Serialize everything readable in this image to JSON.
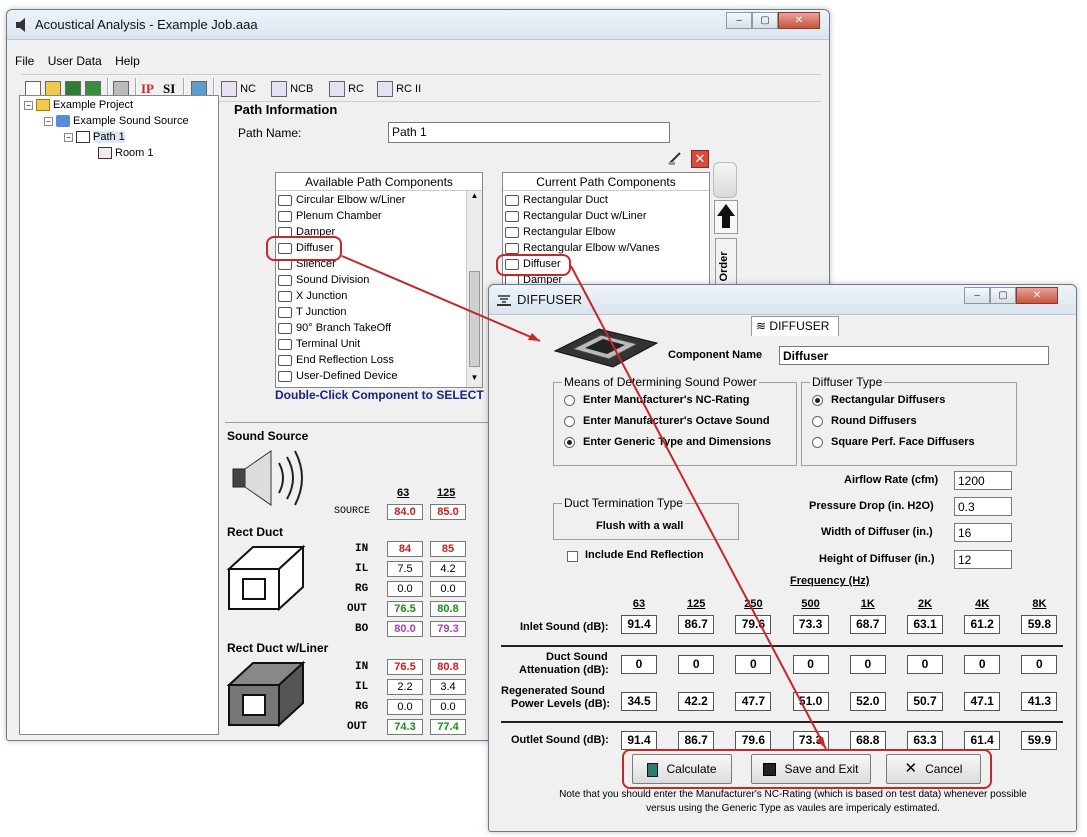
{
  "main_window": {
    "title": "Acoustical Analysis - Example Job.aaa",
    "menu": [
      "File",
      "User Data",
      "Help"
    ],
    "toolbar": {
      "ip": "IP",
      "si": "SI",
      "nc": "NC",
      "ncb": "NCB",
      "rc": "RC",
      "rc2": "RC II"
    }
  },
  "tree": {
    "project": "Example Project",
    "source": "Example Sound Source",
    "path": "Path 1",
    "room": "Room 1"
  },
  "path_info": {
    "heading": "Path Information",
    "name_label": "Path Name:",
    "name_value": "Path 1"
  },
  "available": {
    "header": "Available Path Components",
    "items": [
      "Circular Elbow w/Liner",
      "Plenum Chamber",
      "Damper",
      "Diffuser",
      "Silencer",
      "Sound Division",
      "X Junction",
      "T Junction",
      "90° Branch TakeOff",
      "Terminal Unit",
      "End Reflection Loss",
      "User-Defined Device"
    ],
    "hint": "Double-Click Component to SELECT"
  },
  "current": {
    "header": "Current Path Components",
    "items": [
      "Rectangular Duct",
      "Rectangular Duct w/Liner",
      "Rectangular Elbow",
      "Rectangular Elbow w/Vanes",
      "Diffuser",
      "Damper"
    ],
    "order_label": "ent Order"
  },
  "analysis": {
    "sound_source_label": "Sound Source",
    "freq_headers": [
      "63",
      "125"
    ],
    "source_label": "SOURCE",
    "source_values": [
      "84.0",
      "85.0"
    ],
    "rect_duct_label": "Rect Duct",
    "rect_duct_rows": [
      {
        "label": "IN",
        "values": [
          "84",
          "85"
        ],
        "color": "red"
      },
      {
        "label": "IL",
        "values": [
          "7.5",
          "4.2"
        ],
        "color": "plain"
      },
      {
        "label": "RG",
        "values": [
          "0.0",
          "0.0"
        ],
        "color": "plain"
      },
      {
        "label": "OUT",
        "values": [
          "76.5",
          "80.8"
        ],
        "color": "green"
      },
      {
        "label": "BO",
        "values": [
          "80.0",
          "79.3"
        ],
        "color": "purple"
      }
    ],
    "rect_duct_liner_label": "Rect Duct w/Liner",
    "rect_duct_liner_rows": [
      {
        "label": "IN",
        "values": [
          "76.5",
          "80.8"
        ],
        "color": "red"
      },
      {
        "label": "IL",
        "values": [
          "2.2",
          "3.4"
        ],
        "color": "plain"
      },
      {
        "label": "RG",
        "values": [
          "0.0",
          "0.0"
        ],
        "color": "plain"
      },
      {
        "label": "OUT",
        "values": [
          "74.3",
          "77.4"
        ],
        "color": "green"
      }
    ]
  },
  "dialog": {
    "title": "DIFFUSER",
    "tab": "DIFFUSER",
    "component_name_label": "Component Name",
    "component_name_value": "Diffuser",
    "means_title": "Means of Determining Sound Power",
    "means_options": [
      "Enter Manufacturer's NC-Rating",
      "Enter Manufacturer's Octave Sound",
      "Enter Generic Type and Dimensions"
    ],
    "means_selected": 2,
    "type_title": "Diffuser Type",
    "type_options": [
      "Rectangular Diffusers",
      "Round Diffusers",
      "Square Perf. Face Diffusers"
    ],
    "type_selected": 0,
    "airflow_label": "Airflow Rate (cfm)",
    "airflow_value": "1200",
    "pressure_label": "Pressure Drop (in. H2O)",
    "pressure_value": "0.3",
    "width_label": "Width of Diffuser (in.)",
    "width_value": "16",
    "height_label": "Height of Diffuser (in.)",
    "height_value": "12",
    "termination_title": "Duct Termination Type",
    "termination_value": "Flush with a wall",
    "end_reflection_label": "Include End Reflection",
    "frequency_title": "Frequency (Hz)",
    "bands": [
      "63",
      "125",
      "250",
      "500",
      "1K",
      "2K",
      "4K",
      "8K"
    ],
    "inlet_label": "Inlet Sound (dB):",
    "inlet": [
      "91.4",
      "86.7",
      "79.6",
      "73.3",
      "68.7",
      "63.1",
      "61.2",
      "59.8"
    ],
    "atten_label_1": "Duct Sound",
    "atten_label_2": "Attenuation (dB):",
    "atten": [
      "0",
      "0",
      "0",
      "0",
      "0",
      "0",
      "0",
      "0"
    ],
    "regen_label_1": "Regenerated Sound",
    "regen_label_2": "Power Levels (dB):",
    "regen": [
      "34.5",
      "42.2",
      "47.7",
      "51.0",
      "52.0",
      "50.7",
      "47.1",
      "41.3"
    ],
    "outlet_label": "Outlet Sound (dB):",
    "outlet": [
      "91.4",
      "86.7",
      "79.6",
      "73.3",
      "68.8",
      "63.3",
      "61.4",
      "59.9"
    ],
    "calculate": "Calculate",
    "save_exit": "Save and Exit",
    "cancel": "Cancel",
    "note_1": "Note that you should enter the Manufacturer's NC-Rating (which is based on test data) whenever possible",
    "note_2": "versus using the Generic Type as vaules are impericaly estimated."
  },
  "colors": {
    "annotation": "#c62828",
    "hint": "#1a237e"
  }
}
